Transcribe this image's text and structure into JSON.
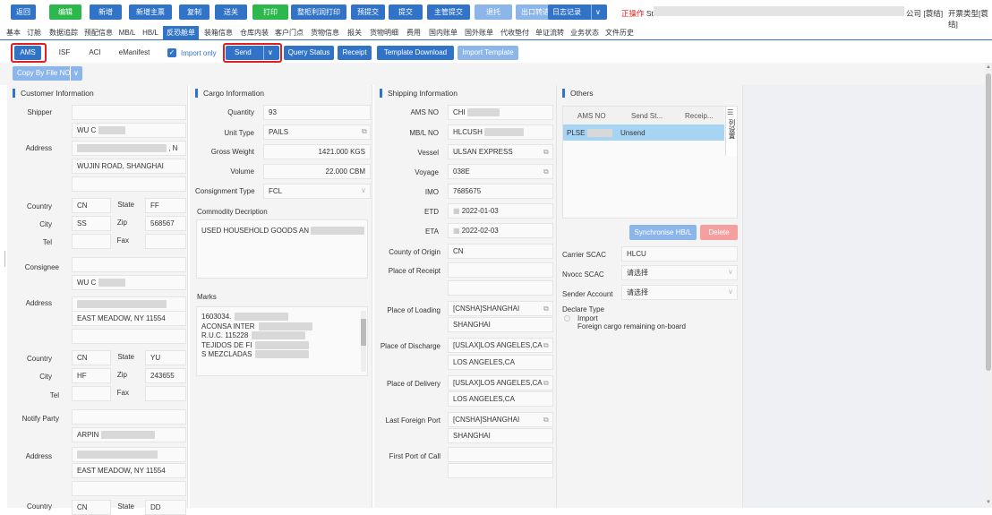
{
  "toolbar": {
    "buttons": [
      {
        "label": "返回",
        "color": "#3174c7"
      },
      {
        "label": "编辑",
        "color": "#2db84d"
      },
      {
        "label": "新增",
        "color": "#3174c7"
      },
      {
        "label": "新增主票",
        "color": "#3174c7"
      },
      {
        "label": "复制",
        "color": "#3174c7"
      },
      {
        "label": "送关",
        "color": "#3174c7"
      },
      {
        "label": "打印",
        "color": "#2db84d"
      },
      {
        "label": "整柜利润打印",
        "color": "#3174c7"
      },
      {
        "label": "预提交",
        "color": "#3174c7"
      },
      {
        "label": "提交",
        "color": "#3174c7"
      },
      {
        "label": "主管提交",
        "color": "#3174c7"
      },
      {
        "label": "退托",
        "color": "#8cb6ea"
      },
      {
        "label": "出口转进口",
        "color": "#8cb6ea"
      }
    ],
    "log_label": "日志记录",
    "operating_label": "正操作",
    "operating_user": "St",
    "company_label": "公司 [蓑结]",
    "invoice_type": "开票类型[蓑结]"
  },
  "tabs": [
    "基本",
    "订舱",
    "数据追踪",
    "预配信息",
    "MB/L",
    "HB/L",
    "反恐舱单",
    "装箱信息",
    "仓库内装",
    "客户门点",
    "货物信息",
    "报关",
    "货物明细",
    "费用",
    "国内账单",
    "国外账单",
    "代收垫付",
    "单证流转",
    "业务状态",
    "文件历史"
  ],
  "active_tab_index": 6,
  "subtabs": [
    "AMS",
    "ISF",
    "ACI",
    "eManifest"
  ],
  "import_only_label": "Import only",
  "actions": {
    "send": "Send",
    "query": "Query Status",
    "receipt": "Receipt",
    "template_download": "Template Download",
    "import_template": "Import Template"
  },
  "copy_by_file": "Copy By File NO",
  "customer": {
    "title": "Customer Information",
    "shipper_label": "Shipper",
    "shipper_name": "WU C",
    "address_label": "Address",
    "shipper_addr2": "WUJIN ROAD, SHANGHAI",
    "country_label": "Country",
    "state_label": "State",
    "city_label": "City",
    "zip_label": "Zip",
    "tel_label": "Tel",
    "fax_label": "Fax",
    "shipper_country": "CN",
    "shipper_state": "FF",
    "shipper_city": "SS",
    "shipper_zip": "568567",
    "consignee_label": "Consignee",
    "consignee_name": "WU C",
    "consignee_addr2": "EAST MEADOW, NY 11554",
    "consignee_country": "CN",
    "consignee_state": "YU",
    "consignee_city": "HF",
    "consignee_zip": "243655",
    "notify_label": "Notify Party",
    "notify_name": "ARPIN",
    "notify_addr2": "EAST MEADOW, NY 11554",
    "notify_country": "CN",
    "notify_state": "DD"
  },
  "cargo": {
    "title": "Cargo Information",
    "quantity_label": "Quantity",
    "quantity": "93",
    "unit_type_label": "Unit Type",
    "unit_type": "PAILS",
    "gross_weight_label": "Gross Weight",
    "gross_weight": "1421.000",
    "weight_unit": "KGS",
    "volume_label": "Volume",
    "volume": "22.000",
    "volume_unit": "CBM",
    "consignment_label": "Consignment Type",
    "consignment": "FCL",
    "commodity_label": "Commodity Decription",
    "commodity": "USED HOUSEHOLD GOODS AN",
    "marks_label": "Marks",
    "marks_lines": [
      "1603034.",
      "ACONSA INTER",
      "R.U.C. 115228",
      "TEJIDOS DE FI",
      "S MEZCLADAS"
    ]
  },
  "shipping": {
    "title": "Shipping Information",
    "ams_no_label": "AMS NO",
    "ams_no": "CHI",
    "mbl_label": "MB/L NO",
    "mbl": "HLCUSH",
    "vessel_label": "Vessel",
    "vessel": "ULSAN EXPRESS",
    "voyage_label": "Voyage",
    "voyage": "038E",
    "imo_label": "IMO",
    "imo": "7685675",
    "etd_label": "ETD",
    "etd": "2022-01-03",
    "eta_label": "ETA",
    "eta": "2022-02-03",
    "origin_label": "County of Origin",
    "origin": "CN",
    "receipt_label": "Place of Receipt",
    "loading_label": "Place of Loading",
    "loading": "[CNSHA]SHANGHAI",
    "loading2": "SHANGHAI",
    "discharge_label": "Place of Discharge",
    "discharge": "[USLAX]LOS ANGELES,CA",
    "discharge2": "LOS ANGELES,CA",
    "delivery_label": "Place of Delivery",
    "delivery": "[USLAX]LOS ANGELES,CA",
    "delivery2": "LOS ANGELES,CA",
    "last_port_label": "Last Foreign Port",
    "last_port": "[CNSHA]SHANGHAI",
    "last_port2": "SHANGHAI",
    "first_port_label": "First Port of Call"
  },
  "others": {
    "title": "Others",
    "col_ams": "AMS NO",
    "col_send": "Send St...",
    "col_receipt": "Receip...",
    "row_ams": "PLSE",
    "row_send": "Unsend",
    "side_tab": "列设置",
    "sync_label": "Synchronise HB/L",
    "delete_label": "Delete",
    "carrier_label": "Carrier SCAC",
    "carrier": "HLCU",
    "nvocc_label": "Nvocc SCAC",
    "nvocc": "请选择",
    "sender_label": "Sender Account",
    "sender": "请选择",
    "declare_label": "Declare Type",
    "declare_opt1": "Import",
    "declare_opt2": "Foreign cargo remaining on-board"
  }
}
